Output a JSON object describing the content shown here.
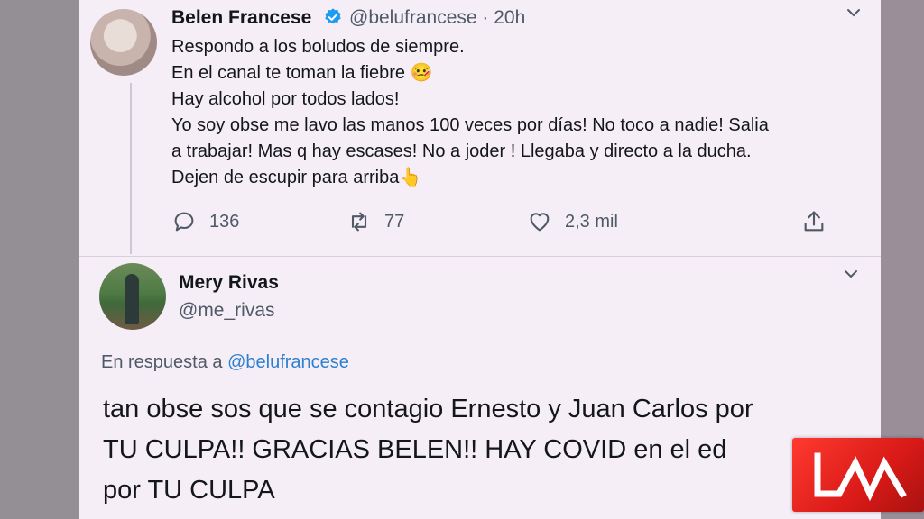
{
  "tweet1": {
    "name": "Belen Francese",
    "handle": "@belufrancese · 20h",
    "lines": [
      "Respondo a los boludos de siempre.",
      "En el canal te toman la fiebre 🤒",
      "Hay alcohol por todos lados!",
      "Yo soy obse me lavo las manos 100 veces por días! No toco  a nadie! Salia",
      "a trabajar! Mas q hay escases! No a joder ! Llegaba y directo a la ducha.",
      "Dejen de escupir para arriba👆"
    ],
    "replies": "136",
    "retweets": "77",
    "likes": "2,3 mil",
    "icons": [
      "reply-icon",
      "retweet-icon",
      "like-icon",
      "share-icon"
    ]
  },
  "tweet2": {
    "name": "Mery Rivas",
    "handle": "@me_rivas",
    "reply_prefix": "En respuesta a ",
    "reply_mention": "@belufrancese",
    "lines": [
      "tan obse sos que se contagio Ernesto y Juan Carlos por",
      "TU CULPA!! GRACIAS BELEN!! HAY COVID en el ed",
      "por TU CULPA"
    ]
  },
  "colors": {
    "card_bg": "#f5eef7",
    "verified": "#1d9bf0",
    "mention": "#2b7fd0",
    "logo_red": "#e2231a"
  }
}
